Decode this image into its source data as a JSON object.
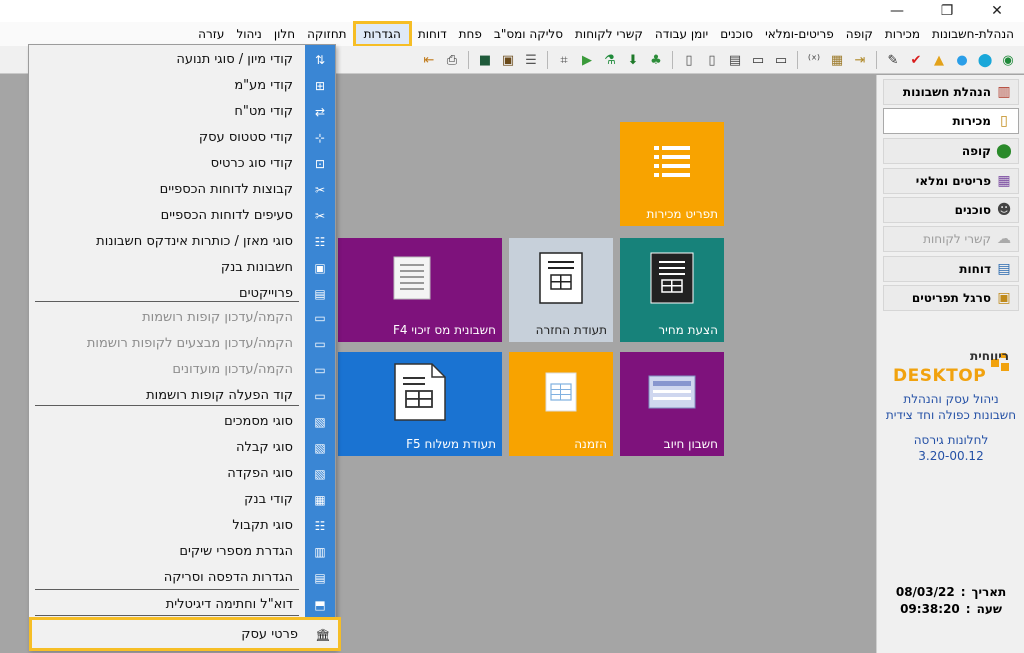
{
  "window": {
    "close_glyph": "✕",
    "maximize_glyph": "❐",
    "minimize_glyph": "—"
  },
  "menubar": {
    "items": [
      "הנהלת-חשבונות",
      "מכירות",
      "קופה",
      "פריטים-ומלאי",
      "סוכנים",
      "יומן עבודה",
      "קשרי לקוחות",
      "סליקה ומס\"ב",
      "פחת",
      "דוחות",
      "הגדרות",
      "תחזוקה",
      "חלון",
      "ניהול",
      "עזרה"
    ],
    "active": "הגדרות"
  },
  "toolbar": {
    "icons": [
      "online-icon",
      "edit-badge-icon",
      "online-circle-icon",
      "warning-icon",
      "checkmark-icon",
      "brush-icon",
      "sidebar-icon",
      "calculator-icon",
      "formula-icon",
      "card-icon",
      "card2-icon",
      "calendar-icon",
      "document-icon",
      "page-icon",
      "plant-icon",
      "download-icon",
      "flask-icon",
      "play-icon",
      "grid-icon",
      "list-icon",
      "film-icon",
      "book-icon",
      "print-icon",
      "exit-icon"
    ]
  },
  "dropdown": {
    "items": [
      {
        "label": "קודי מיון / סוגי תנועה",
        "icon": "sort-icon",
        "enabled": true
      },
      {
        "label": "קודי מע\"מ",
        "icon": "vat-icon",
        "enabled": true
      },
      {
        "label": "קודי מט\"ח",
        "icon": "currency-icon",
        "enabled": true
      },
      {
        "label": "קודי סטטוס עסק",
        "icon": "status-icon",
        "enabled": true
      },
      {
        "label": "קודי סוג כרטיס",
        "icon": "card-type-icon",
        "enabled": true
      },
      {
        "label": "קבוצות לדוחות הכספיים",
        "icon": "groups-icon",
        "enabled": true
      },
      {
        "label": "סעיפים לדוחות הכספיים",
        "icon": "sections-icon",
        "enabled": true
      },
      {
        "label": "סוגי מאזן / כותרות אינדקס חשבונות",
        "icon": "balance-icon",
        "enabled": true
      },
      {
        "label": "חשבונות בנק",
        "icon": "bank-account-icon",
        "enabled": true
      },
      {
        "label": "פרוייקטים",
        "icon": "projects-icon",
        "enabled": true
      },
      {
        "separator": true
      },
      {
        "label": "הקמה/עדכון קופות רושמות",
        "icon": "register-icon",
        "enabled": false
      },
      {
        "label": "הקמה/עדכון מבצעים לקופות רושמות",
        "icon": "promotion-icon",
        "enabled": false
      },
      {
        "label": "הקמה/עדכון מועדונים",
        "icon": "club-icon",
        "enabled": false
      },
      {
        "label": "קוד הפעלה קופות רושמות",
        "icon": "activation-icon",
        "enabled": true
      },
      {
        "separator": true
      },
      {
        "label": "סוגי מסמכים",
        "icon": "doc-types-icon",
        "enabled": true
      },
      {
        "label": "סוגי קבלה",
        "icon": "receipt-types-icon",
        "enabled": true
      },
      {
        "label": "סוגי הפקדה",
        "icon": "deposit-types-icon",
        "enabled": true
      },
      {
        "label": "קודי בנק",
        "icon": "bank-codes-icon",
        "enabled": true
      },
      {
        "label": "סוגי תקבול",
        "icon": "payment-types-icon",
        "enabled": true
      },
      {
        "label": "הגדרת מספרי שיקים",
        "icon": "check-numbers-icon",
        "enabled": true
      },
      {
        "label": "הגדרות הדפסה וסריקה",
        "icon": "print-scan-icon",
        "enabled": true
      },
      {
        "separator": true
      },
      {
        "label": "דוא\"ל וחתימה דיגיטלית",
        "icon": "email-signature-icon",
        "enabled": true
      },
      {
        "separator": true
      },
      {
        "label": "פרטי עסק",
        "icon": "business-details-icon",
        "enabled": true,
        "highlighted": true
      }
    ]
  },
  "tiles": [
    {
      "label": "תפריט מכירות",
      "color": "#f8a300",
      "icon": "menu-list-icon"
    },
    {
      "label": "הצעת מחיר",
      "color": "#17827a",
      "icon": "price-quote-icon"
    },
    {
      "label": "תעודת החזרה",
      "color": "#c7d0da",
      "icon": "return-doc-icon"
    },
    {
      "label": "חשבונית מס זיכוי F4",
      "color": "#7e127c",
      "icon": "credit-invoice-icon"
    },
    {
      "label": "חשבון חיוב",
      "color": "#7e127c",
      "icon": "debit-account-icon"
    },
    {
      "label": "הזמנה",
      "color": "#f8a300",
      "icon": "order-icon"
    },
    {
      "label": "תעודת משלוח F5",
      "color": "#1a73d2",
      "icon": "delivery-doc-icon"
    }
  ],
  "rightpanel": {
    "nav": [
      {
        "label": "הנהלת חשבונות",
        "icon": "accounting-icon",
        "selected": false,
        "enabled": true
      },
      {
        "label": "מכירות",
        "icon": "sales-icon",
        "selected": true,
        "enabled": true
      },
      {
        "label": "קופה",
        "icon": "cashbox-icon",
        "selected": false,
        "enabled": true
      },
      {
        "label": "פריטים ומלאי",
        "icon": "inventory-icon",
        "selected": false,
        "enabled": true
      },
      {
        "label": "סוכנים",
        "icon": "agents-icon",
        "selected": false,
        "enabled": true
      },
      {
        "label": "קשרי לקוחות",
        "icon": "crm-icon",
        "selected": false,
        "enabled": false
      },
      {
        "label": "דוחות",
        "icon": "reports-icon",
        "selected": false,
        "enabled": true
      },
      {
        "label": "סרגל תפריטים",
        "icon": "menu-bar-icon",
        "selected": false,
        "enabled": true
      }
    ],
    "logo": {
      "top_text": "ריווחית",
      "brand": "DESKTOP"
    },
    "tagline": [
      "ניהול עסק והנהלת",
      "חשבונות כפולה וחד צידית"
    ],
    "version": [
      "לחלונות גירסה",
      "3.20-00.12"
    ],
    "date_label": "תאריך",
    "date_value": "08/03/22",
    "time_label": "שעה",
    "time_value": "09:38:20"
  },
  "colors": {
    "accent_highlight": "#f6be26",
    "dropdown_strip": "#3a86d4",
    "workspace": "#a5a5a5",
    "link_blue": "#2551a6"
  }
}
